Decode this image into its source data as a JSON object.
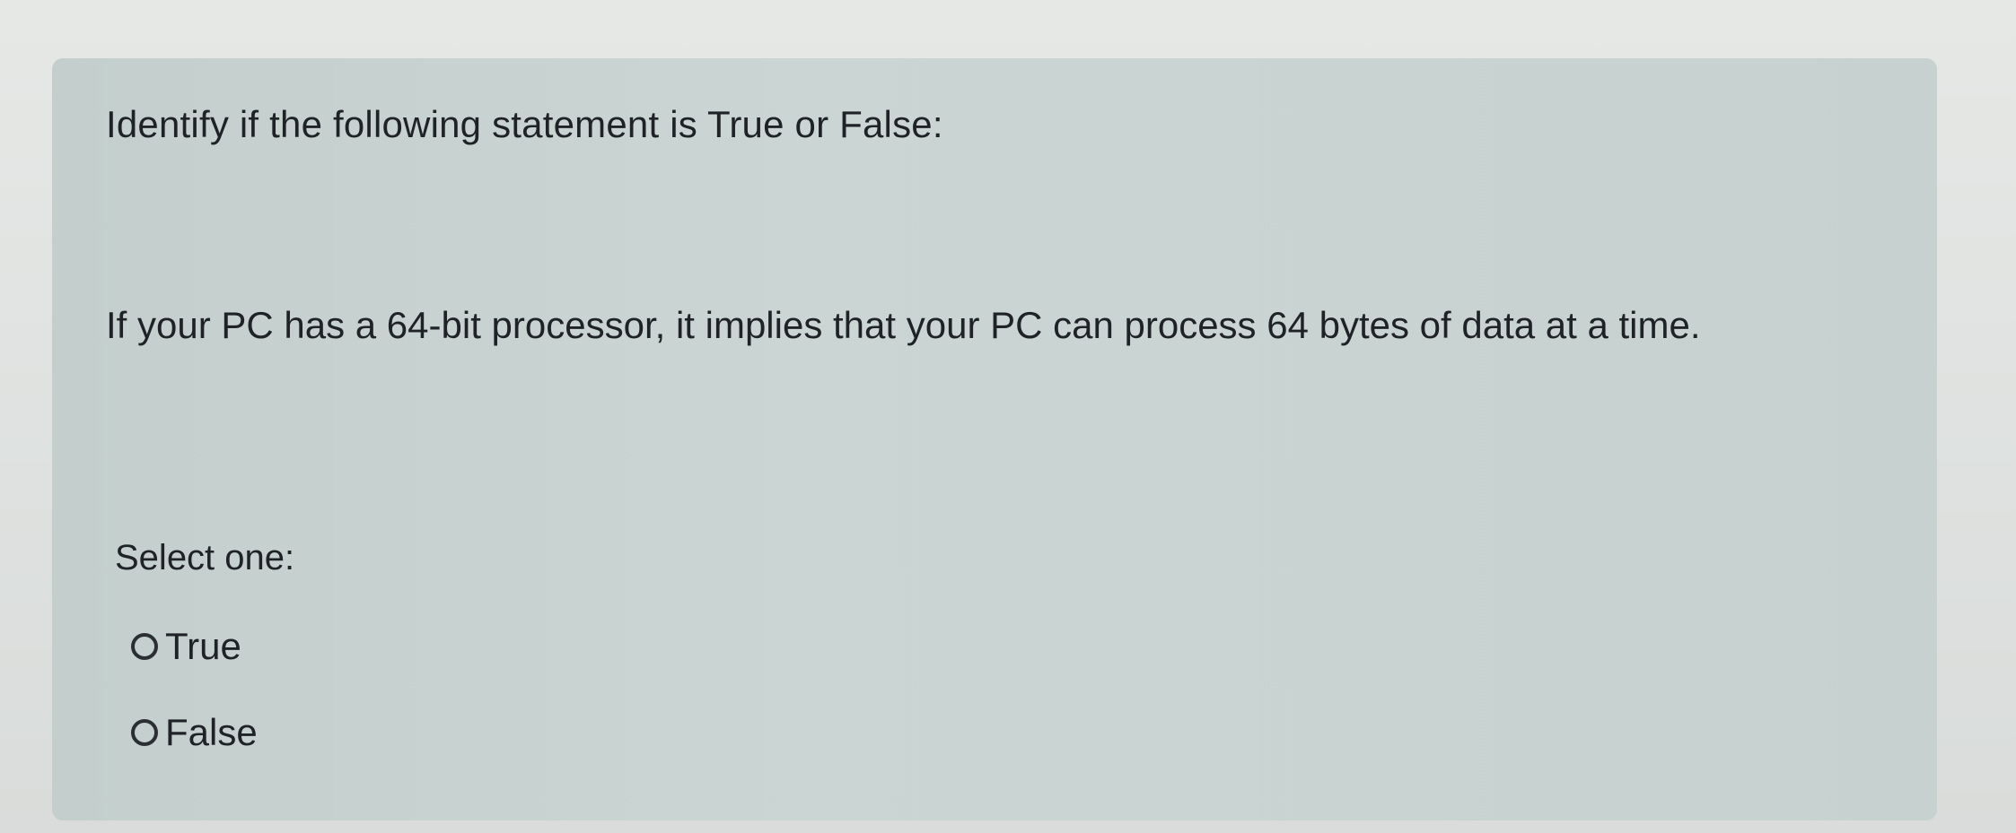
{
  "question": {
    "prompt": "Identify if the following statement is True or False:",
    "statement": "If your PC has a 64-bit processor, it implies that your PC can process 64 bytes of data at a time.",
    "select_label": "Select one:",
    "options": [
      {
        "label": "True",
        "selected": false
      },
      {
        "label": "False",
        "selected": false
      }
    ]
  }
}
